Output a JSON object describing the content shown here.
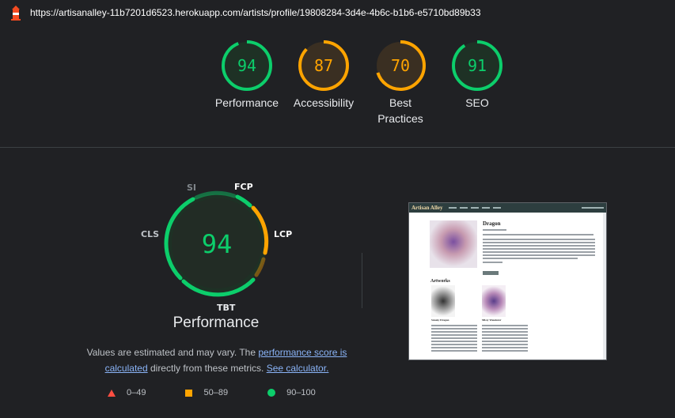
{
  "url": "https://artisanalley-11b7201d6523.herokuapp.com/artists/profile/19808284-3d4e-4b6c-b1b6-e5710bd89b33",
  "colors": {
    "pass": "#0cce6b",
    "average": "#ffa400",
    "fail": "#ff4e42",
    "pass_bg": "#1e3125",
    "average_bg": "#3a2f22"
  },
  "categories": [
    {
      "score": "94",
      "label": "Performance",
      "value": 0.94,
      "rating": "pass"
    },
    {
      "score": "87",
      "label": "Accessibility",
      "value": 0.87,
      "rating": "average"
    },
    {
      "score": "70",
      "label": "Best Practices",
      "value": 0.7,
      "rating": "average"
    },
    {
      "score": "91",
      "label": "SEO",
      "value": 0.91,
      "rating": "pass"
    }
  ],
  "performance": {
    "score": "94",
    "title": "Performance",
    "metrics": [
      {
        "key": "SI",
        "rating": "pass"
      },
      {
        "key": "FCP",
        "rating": "average"
      },
      {
        "key": "LCP",
        "rating": "average"
      },
      {
        "key": "TBT",
        "rating": "pass"
      },
      {
        "key": "CLS",
        "rating": "pass"
      }
    ],
    "note_prefix": "Values are estimated and may vary. The ",
    "note_link1": "performance score is calculated",
    "note_mid": " directly from these metrics. ",
    "note_link2": "See calculator."
  },
  "legend": [
    {
      "range": "0–49",
      "icon": "triangle-icon"
    },
    {
      "range": "50–89",
      "icon": "square-icon"
    },
    {
      "range": "90–100",
      "icon": "circle-icon"
    }
  ],
  "screenshot": {
    "brand": "Artisan Alley",
    "heading": "Dragon",
    "section": "Artworks",
    "card1_title": "Smoky Dragon",
    "card2_title": "Misty Wanderer"
  }
}
